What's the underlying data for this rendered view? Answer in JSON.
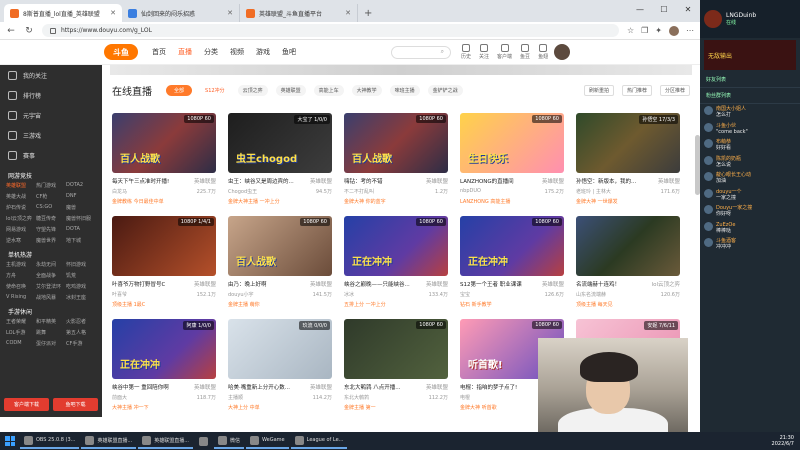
{
  "browser": {
    "tabs": [
      {
        "label": "8斯普直播_lol直播_英雄联盟",
        "active": true
      },
      {
        "label": "仙剑回来的闷乐招惑",
        "active": false
      },
      {
        "label": "英雄联盟_斗鱼直播平台",
        "active": false
      }
    ],
    "url": "https://www.douyu.com/g_LOL"
  },
  "site": {
    "logo": "斗鱼",
    "nav": [
      "首页",
      "直播",
      "分类",
      "视频",
      "游戏",
      "鱼吧"
    ],
    "active_nav": "直播",
    "search_icon": "search-icon",
    "header_icons": [
      "历史",
      "关注",
      "客户端",
      "鱼豆",
      "鱼翅"
    ]
  },
  "sidebar": {
    "items": [
      "我的关注",
      "排行榜",
      "元宇宙",
      "三游戏",
      "赛事"
    ],
    "section1": "网游竞技",
    "grid1": [
      "英雄联盟",
      "热门游戏",
      "DOTA2",
      "英雄大战",
      "CF枪",
      "DNF",
      "炉石传说",
      "CS:GO",
      "魔兽",
      "lol云顶之弈",
      "糖豆传奇",
      "魔兽怀旧服",
      "网易游戏",
      "守望先锋",
      "DOTA",
      "逆水寒",
      "魔兽世界",
      "地下城"
    ],
    "section2": "单机热游",
    "grid2": [
      "主机游戏",
      "永劫无间",
      "怀旧游戏",
      "方舟",
      "全面战争",
      "饥荒",
      "使命召唤",
      "艾尔登法环",
      "吃鸡游戏",
      "V Rising",
      "战地风暴",
      "冰封王座"
    ],
    "section3": "手游休闲",
    "grid3": [
      "王者荣耀",
      "和平精英",
      "火影忍者",
      "LOL手游",
      "跳舞",
      "第五人格",
      "CODM",
      "蛋仔派对",
      "CF手游"
    ],
    "btn1": "客户端下载",
    "btn2": "鱼吧下载"
  },
  "main": {
    "title": "在线直播",
    "filter_all": "全部",
    "chips": [
      "S12冲分",
      "云顶之弈",
      "英雄联盟",
      "高能上车",
      "大神教学",
      "味班主播",
      "金铲铲之战",
      "娱乐"
    ],
    "hot_chip": "S12冲分",
    "tools": [
      "刷新重拍",
      "热门推荐",
      "分区推荐"
    ],
    "cards": [
      {
        "title": "每天下午三点准时开播!",
        "cat": "英雄联盟",
        "streamer": "白龙马",
        "viewers": "225.7万",
        "tag": "金牌教练 今日最佳中单",
        "theme": "blue",
        "badge": "1080P 60",
        "big": "百人战歌"
      },
      {
        "title": "虫王：峡谷又是周边宾的...",
        "cat": "英雄联盟",
        "streamer": "Chogod虫王",
        "viewers": "94.5万",
        "tag": "金牌大神主播 一冲上分",
        "theme": "dark",
        "badge": "大宝了 1/0/0",
        "big": "虫王chogod"
      },
      {
        "title": "嗨钻：考的不错",
        "cat": "英雄联盟",
        "streamer": "不二不打乱叫",
        "viewers": "1.2万",
        "tag": "金牌大神 你的蓝字",
        "theme": "blue",
        "badge": "1080P 60",
        "big": "百人战歌"
      },
      {
        "title": "LANZHONG的直播间",
        "cat": "英雄联盟",
        "streamer": "nbpDUO",
        "viewers": "175.2万",
        "tag": "LANZHONG 高能主播",
        "theme": "bday",
        "badge": "1080P 60",
        "big": "生日快乐"
      },
      {
        "title": "孙悟空：新版本，我的...",
        "cat": "英雄联盟",
        "streamer": "老班玲 | 主林大",
        "viewers": "171.6万",
        "tag": "金牌大神 一世爆发",
        "theme": "game",
        "badge": "孙悟空 17/3/3",
        "big": ""
      },
      {
        "title": "叶喜爷万物打野冒号C",
        "cat": "英雄联盟",
        "streamer": "叶喜爷",
        "viewers": "152.1万",
        "tag": "顶级主播 1最C",
        "theme": "red",
        "badge": "1080P 1/4/1",
        "big": ""
      },
      {
        "title": "由乃：晚上好啊",
        "cat": "英雄联盟",
        "streamer": "douyu小宇",
        "viewers": "141.5万",
        "tag": "金牌主播 萌你",
        "theme": "girl",
        "badge": "1080P 60",
        "big": "百人战歌"
      },
      {
        "title": "峡谷之巅晚——只能峡谷...",
        "cat": "英雄联盟",
        "streamer": "冰冰",
        "viewers": "133.4万",
        "tag": "五排上分 一冲上分",
        "theme": "peak",
        "badge": "1080P 60",
        "big": "正在冲冲"
      },
      {
        "title": "S12第一个王者 职业课课",
        "cat": "英雄联盟",
        "streamer": "宝宝",
        "viewers": "126.6万",
        "tag": "钻石 新手教学",
        "theme": "peak",
        "badge": "1080P 60",
        "big": "正在冲冲"
      },
      {
        "title": "名流端赫十连鸡！",
        "cat": "lol云顶之弈",
        "streamer": "山东名流端赫",
        "viewers": "120.6万",
        "tag": "顶级主播 每天见",
        "theme": "game2",
        "badge": "",
        "big": ""
      },
      {
        "title": "峡谷中第一 重回陪你啊",
        "cat": "英雄联盟",
        "streamer": "前面大",
        "viewers": "118.7万",
        "tag": "大神主播 冲一下",
        "theme": "peak",
        "badge": "阿康 1/0/0",
        "big": "正在冲冲"
      },
      {
        "title": "哈美·嘴重新上分开心数...",
        "cat": "英雄联盟",
        "streamer": "主播顺",
        "viewers": "114.2万",
        "tag": "大神上分 中单",
        "theme": "seal",
        "badge": "玖流 0/0/0",
        "big": ""
      },
      {
        "title": "东北大鹌鹑 八点开播...",
        "cat": "英雄联盟",
        "streamer": "东北大鹌鹑",
        "viewers": "112.2万",
        "tag": "金牌主播 第一",
        "theme": "game3",
        "badge": "1080P 60",
        "big": ""
      },
      {
        "title": "电棍：指咱的梦子点了!",
        "cat": "英雄联盟",
        "streamer": "电棍",
        "viewers": "108.1万",
        "tag": "金牌大神 听首歌",
        "theme": "song",
        "badge": "1080P 60",
        "big": "听首歌!"
      },
      {
        "title": "",
        "cat": "",
        "streamer": "",
        "viewers": "",
        "tag": "",
        "theme": "pink",
        "badge": "安妮 7/6/11",
        "big": ""
      }
    ]
  },
  "chat": {
    "name": "LNGDuinb",
    "sub": "在线",
    "banner": "无敌输出",
    "sections": [
      "好友列表",
      "粉丝群列表"
    ],
    "messages": [
      {
        "user": "南国大小姐人",
        "text": "怎么打"
      },
      {
        "user": "斗鱼小伙",
        "text": "\"come back\""
      },
      {
        "user": "布萌恭",
        "text": "好好看"
      },
      {
        "user": "陈凯的奶瓶",
        "text": "怎么说"
      },
      {
        "user": "靛心眼长王心动",
        "text": "加油"
      },
      {
        "user": "douyu一个",
        "text": "一家之撞"
      },
      {
        "user": "Douyu一家之撞",
        "text": "你好呀"
      },
      {
        "user": "ZuEzOe",
        "text": "棒棒哒"
      },
      {
        "user": "斗鱼酒客",
        "text": "冲冲冲"
      }
    ]
  },
  "taskbar": {
    "apps": [
      "OBS 25.0.8 (3...",
      "英雄联盟直播...",
      "英雄联盟直播...",
      "微信",
      "WeGame",
      "League of Le..."
    ],
    "time": "21:30",
    "date": "2022/6/7"
  }
}
